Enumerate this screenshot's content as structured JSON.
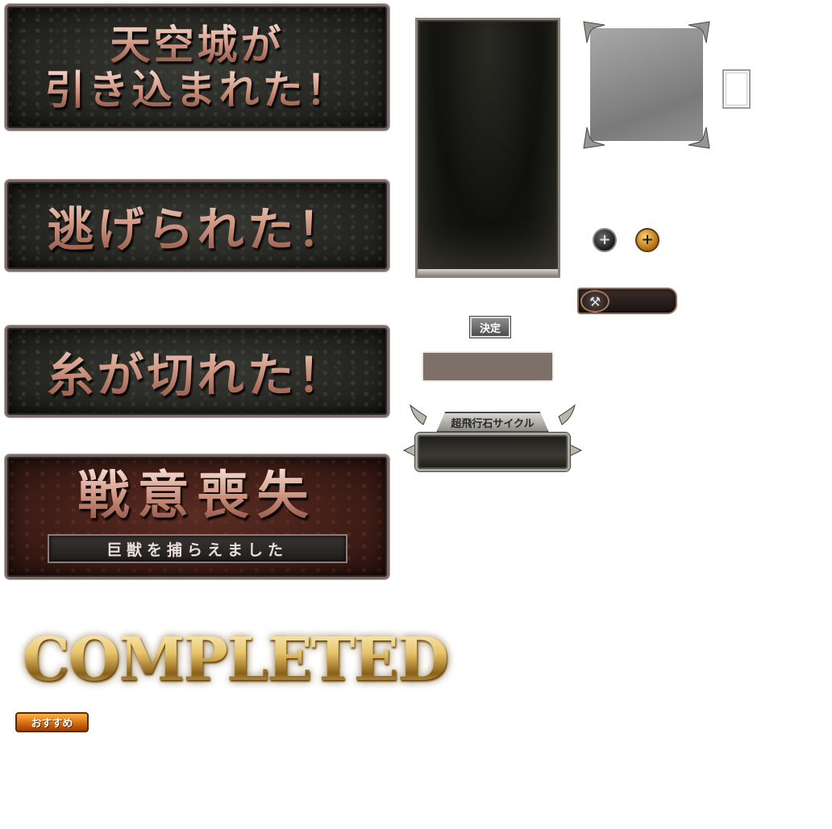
{
  "banners": {
    "sky_castle": {
      "line1": "天空城が",
      "line2": "引き込まれた！"
    },
    "escaped": {
      "text": "逃げられた！"
    },
    "line_cut": {
      "text": "糸が切れた！"
    },
    "lost_will": {
      "title": "戦意喪失",
      "subtitle": "巨獣を捕らえました"
    }
  },
  "decide_button": {
    "label": "決定"
  },
  "ornate_panel": {
    "title": "超飛行石サイクル"
  },
  "completed": {
    "text": "COMPLETED"
  },
  "recommend_badge": {
    "label": "おすすめ"
  },
  "icons": {
    "plus_dark": "plus-icon",
    "plus_gold": "plus-icon",
    "tool": "tool-icon"
  },
  "colors": {
    "banner_text": "#e3b7a8",
    "gold": "#e8c46a",
    "taupe_bar": "#7d7068",
    "orange_badge": "#d4670c"
  }
}
